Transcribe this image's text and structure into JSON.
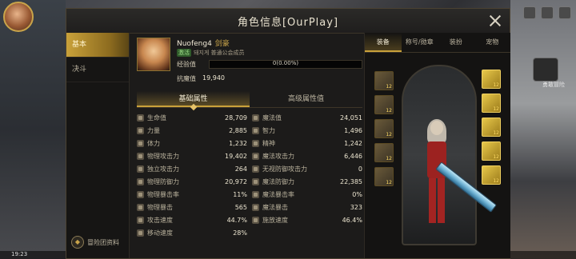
{
  "background": {
    "time": "19:23",
    "right_button_label": "勇敢冒险"
  },
  "dialog": {
    "title": "角色信息[OurPlay]",
    "sidenav": {
      "items": [
        "基本",
        "决斗"
      ],
      "footer": "冒险团资料"
    },
    "profile": {
      "name": "Nuofeng4",
      "class": "剑豪",
      "guild_badge": "激活",
      "guild_text": "돼지게  普通公会成员",
      "xp_label": "经验值",
      "xp_text": "0(0.00%)",
      "xp_fraction": 0.0,
      "resist_label": "抗魔值",
      "resist_value": "19,940"
    },
    "attr_tabs": [
      "基础属性",
      "高级属性值"
    ],
    "stats_left": [
      {
        "name": "生命值",
        "value": "28,709"
      },
      {
        "name": "力量",
        "value": "2,885"
      },
      {
        "name": "体力",
        "value": "1,232"
      },
      {
        "name": "物理攻击力",
        "value": "19,402"
      },
      {
        "name": "独立攻击力",
        "value": "264"
      },
      {
        "name": "物理防御力",
        "value": "20,972"
      },
      {
        "name": "物理暴击率",
        "value": "11%"
      },
      {
        "name": "物理暴击",
        "value": "565"
      },
      {
        "name": "攻击速度",
        "value": "44.7%"
      },
      {
        "name": "移动速度",
        "value": "28%"
      }
    ],
    "stats_right": [
      {
        "name": "魔法值",
        "value": "24,051"
      },
      {
        "name": "智力",
        "value": "1,496"
      },
      {
        "name": "精神",
        "value": "1,242"
      },
      {
        "name": "魔法攻击力",
        "value": "6,446"
      },
      {
        "name": "无视防御攻击力",
        "value": "0"
      },
      {
        "name": "魔法防御力",
        "value": "22,385"
      },
      {
        "name": "魔法暴击率",
        "value": "0%"
      },
      {
        "name": "魔法暴击",
        "value": "323"
      },
      {
        "name": "施放速度",
        "value": "46.4%"
      }
    ],
    "equip_tabs": [
      "装备",
      "称号/勋章",
      "装扮",
      "宠物"
    ],
    "left_slots": [
      "12",
      "12",
      "12",
      "12",
      "12"
    ],
    "right_slots": [
      "12",
      "12",
      "12",
      "12",
      "12"
    ]
  }
}
